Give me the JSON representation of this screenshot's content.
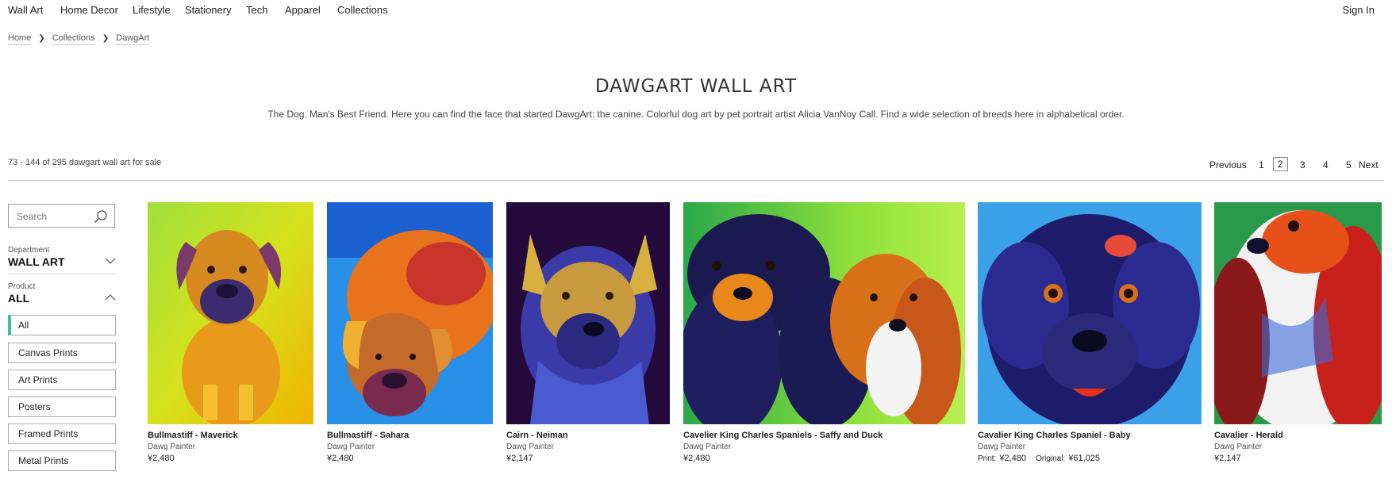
{
  "nav": {
    "items": [
      "Wall Art",
      "Home Decor",
      "Lifestyle",
      "Stationery",
      "Tech",
      "Apparel",
      "Collections"
    ],
    "signin": "Sign In"
  },
  "breadcrumb": [
    "Home",
    "Collections",
    "DawgArt"
  ],
  "page": {
    "title": "DAWGART WALL ART",
    "description": "The Dog. Man's Best Friend. Here you can find the face that started DawgArt: the canine. Colorful dog art by pet portrait artist Alicia VanNoy Call. Find a wide selection of breeds here in alphabetical order."
  },
  "results": {
    "count_text": "73 - 144 of 295 dawgart wall art for sale"
  },
  "pagination": {
    "previous": "Previous",
    "pages": [
      "1",
      "2",
      "3",
      "4",
      "5"
    ],
    "current": "2",
    "next": "Next"
  },
  "sidebar": {
    "search_placeholder": "Search",
    "department": {
      "label": "Department",
      "value": "WALL ART"
    },
    "product": {
      "label": "Product",
      "value": "ALL"
    },
    "filters": [
      "All",
      "Canvas Prints",
      "Art Prints",
      "Posters",
      "Framed Prints",
      "Metal Prints"
    ],
    "active_filter": "All"
  },
  "products": [
    {
      "title": "Bullmastiff - Maverick",
      "artist": "Dawg Painter",
      "price": "¥2,480"
    },
    {
      "title": "Bullmastiff - Sahara",
      "artist": "Dawg Painter",
      "price": "¥2,480"
    },
    {
      "title": "Cairn - Neiman",
      "artist": "Dawg Painter",
      "price": "¥2,147"
    },
    {
      "title": "Cavelier King Charles Spaniels - Saffy and Duck",
      "artist": "Dawg Painter",
      "price": "¥2,480"
    },
    {
      "title": "Cavalier King Charles Spaniel - Baby",
      "artist": "Dawg Painter",
      "print_label": "Print:",
      "print_price": "¥2,480",
      "original_label": "Original:",
      "original_price": "¥61,025"
    },
    {
      "title": "Cavalier - Herald",
      "artist": "Dawg Painter",
      "price": "¥2,147"
    }
  ],
  "colors": {
    "accent": "#3bbdb6",
    "divider": "#cccccc"
  }
}
